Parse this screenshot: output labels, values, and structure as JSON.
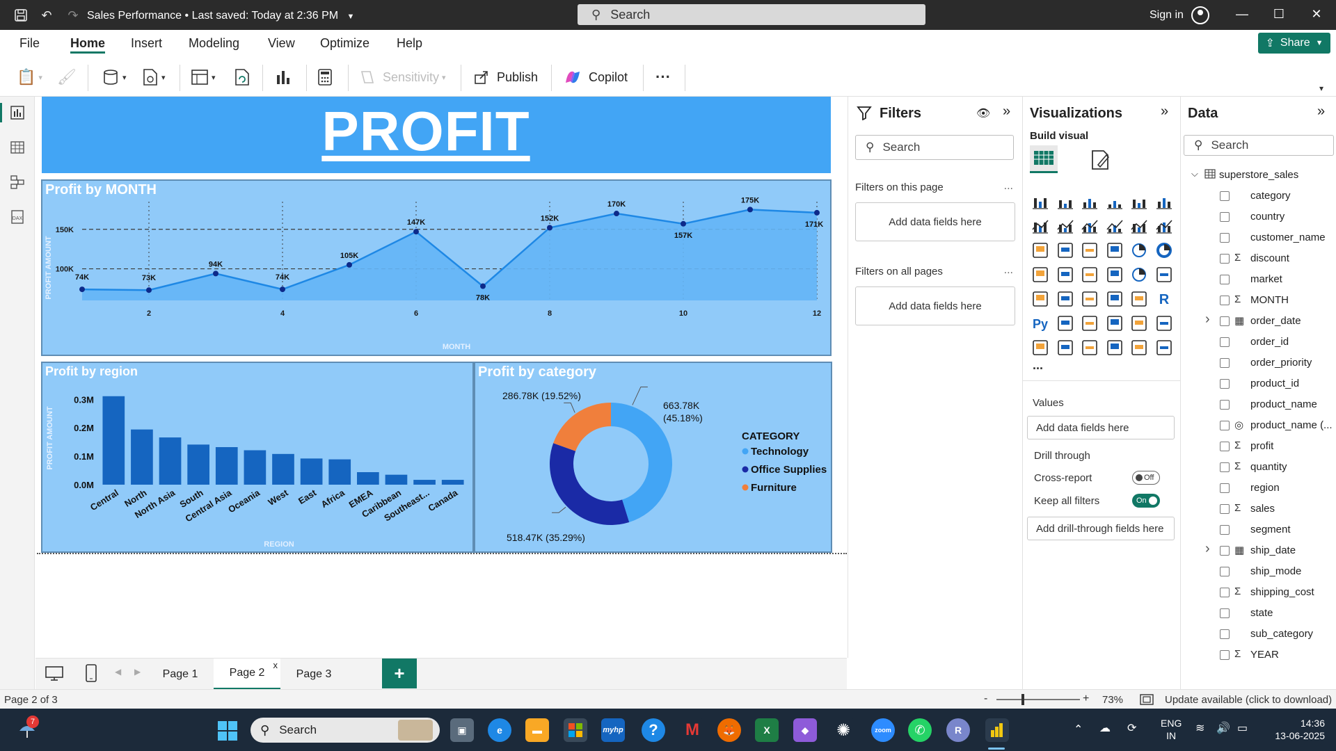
{
  "titlebar": {
    "doc_title": "Sales Performance",
    "saved_status": "Last saved: Today at 2:36 PM",
    "search_placeholder": "Search",
    "signin": "Sign in"
  },
  "menu": {
    "items": [
      "File",
      "Home",
      "Insert",
      "Modeling",
      "View",
      "Optimize",
      "Help"
    ],
    "active": "Home",
    "share": "Share"
  },
  "ribbon": {
    "sensitivity": "Sensitivity",
    "publish": "Publish",
    "copilot": "Copilot"
  },
  "report": {
    "banner_title": "PROFIT",
    "month_chart": {
      "title": "Profit by MONTH",
      "xlabel": "MONTH",
      "ylabel": "PROFIT AMOUNT"
    },
    "region_chart": {
      "title": "Profit by region",
      "xlabel": "REGION",
      "ylabel": "PROFIT AMOUNT"
    },
    "category_chart": {
      "title": "Profit by category",
      "legend_title": "CATEGORY"
    }
  },
  "chart_data": [
    {
      "type": "area",
      "title": "Profit by MONTH",
      "xlabel": "MONTH",
      "ylabel": "PROFIT AMOUNT",
      "x": [
        1,
        2,
        3,
        4,
        5,
        6,
        7,
        8,
        9,
        10,
        11,
        12
      ],
      "values": [
        74,
        73,
        94,
        74,
        105,
        147,
        78,
        152,
        170,
        157,
        175,
        171
      ],
      "data_labels": [
        "74K",
        "73K",
        "94K",
        "74K",
        "105K",
        "147K",
        "78K",
        "152K",
        "170K",
        "157K",
        "175K",
        "171K"
      ],
      "x_ticks": [
        "2",
        "4",
        "6",
        "8",
        "10",
        "12"
      ],
      "y_ticks": [
        "100K",
        "150K"
      ],
      "y_tick_values": [
        100,
        150
      ],
      "unit": "K",
      "ylim": [
        60,
        185
      ],
      "xlim": [
        1,
        12
      ],
      "grid": true,
      "colors": {
        "line": "#1e88e5",
        "fill": "#64b5f6",
        "marker": "#0d2a8a",
        "grid": "#3a3a3a"
      }
    },
    {
      "type": "bar",
      "title": "Profit by region",
      "xlabel": "REGION",
      "ylabel": "PROFIT AMOUNT",
      "categories": [
        "Central",
        "North",
        "North Asia",
        "South",
        "Central Asia",
        "Oceania",
        "West",
        "East",
        "Africa",
        "EMEA",
        "Caribbean",
        "Southeast...",
        "Canada"
      ],
      "values": [
        0.311,
        0.194,
        0.166,
        0.141,
        0.132,
        0.121,
        0.108,
        0.092,
        0.089,
        0.044,
        0.035,
        0.017,
        0.017
      ],
      "y_ticks": [
        "0.0M",
        "0.1M",
        "0.2M",
        "0.3M"
      ],
      "y_tick_values": [
        0.0,
        0.1,
        0.2,
        0.3
      ],
      "unit": "M",
      "ylim": [
        0,
        0.33
      ],
      "colors": {
        "bar": "#1565c0"
      }
    },
    {
      "type": "pie",
      "title": "Profit by category",
      "legend_title": "CATEGORY",
      "legend": "right",
      "slices": [
        {
          "name": "Technology",
          "value": 663.78,
          "percent": 45.18,
          "label_line1": "663.78K",
          "label_line2": "(45.18%)",
          "color": "#42a5f5"
        },
        {
          "name": "Office Supplies",
          "value": 518.47,
          "percent": 35.29,
          "label": "518.47K (35.29%)",
          "color": "#1a2aa6"
        },
        {
          "name": "Furniture",
          "value": 286.78,
          "percent": 19.52,
          "label": "286.78K (19.52%)",
          "color": "#f07f3c"
        }
      ]
    }
  ],
  "filters": {
    "title": "Filters",
    "search_placeholder": "Search",
    "on_this_page": "Filters on this page",
    "on_all_pages": "Filters on all pages",
    "add_fields": "Add data fields here",
    "more": "..."
  },
  "visualizations": {
    "title": "Visualizations",
    "build_visual": "Build visual",
    "more": "...",
    "values_label": "Values",
    "add_fields": "Add data fields here",
    "drill_through": "Drill through",
    "cross_report": "Cross-report",
    "cross_report_state": "Off",
    "keep_all_filters": "Keep all filters",
    "keep_all_filters_state": "On",
    "add_drill": "Add drill-through fields here"
  },
  "data_pane": {
    "title": "Data",
    "search_placeholder": "Search",
    "table_name": "superstore_sales",
    "fields": [
      {
        "name": "category",
        "sigma": false,
        "expand": false,
        "type": ""
      },
      {
        "name": "country",
        "sigma": false,
        "expand": false,
        "type": ""
      },
      {
        "name": "customer_name",
        "sigma": false,
        "expand": false,
        "type": ""
      },
      {
        "name": "discount",
        "sigma": true,
        "expand": false,
        "type": ""
      },
      {
        "name": "market",
        "sigma": false,
        "expand": false,
        "type": ""
      },
      {
        "name": "MONTH",
        "sigma": true,
        "expand": false,
        "type": ""
      },
      {
        "name": "order_date",
        "sigma": false,
        "expand": true,
        "type": "calendar"
      },
      {
        "name": "order_id",
        "sigma": false,
        "expand": false,
        "type": ""
      },
      {
        "name": "order_priority",
        "sigma": false,
        "expand": false,
        "type": ""
      },
      {
        "name": "product_id",
        "sigma": false,
        "expand": false,
        "type": ""
      },
      {
        "name": "product_name",
        "sigma": false,
        "expand": false,
        "type": ""
      },
      {
        "name": "product_name (...",
        "sigma": false,
        "expand": false,
        "type": "group"
      },
      {
        "name": "profit",
        "sigma": true,
        "expand": false,
        "type": ""
      },
      {
        "name": "quantity",
        "sigma": true,
        "expand": false,
        "type": ""
      },
      {
        "name": "region",
        "sigma": false,
        "expand": false,
        "type": ""
      },
      {
        "name": "sales",
        "sigma": true,
        "expand": false,
        "type": ""
      },
      {
        "name": "segment",
        "sigma": false,
        "expand": false,
        "type": ""
      },
      {
        "name": "ship_date",
        "sigma": false,
        "expand": true,
        "type": "calendar"
      },
      {
        "name": "ship_mode",
        "sigma": false,
        "expand": false,
        "type": ""
      },
      {
        "name": "shipping_cost",
        "sigma": true,
        "expand": false,
        "type": ""
      },
      {
        "name": "state",
        "sigma": false,
        "expand": false,
        "type": ""
      },
      {
        "name": "sub_category",
        "sigma": false,
        "expand": false,
        "type": ""
      },
      {
        "name": "YEAR",
        "sigma": true,
        "expand": false,
        "type": ""
      }
    ]
  },
  "pages": {
    "tabs": [
      "Page 1",
      "Page 2",
      "Page 3"
    ],
    "active": "Page 2",
    "add": "+"
  },
  "status": {
    "page_info": "Page 2 of 3",
    "zoom_minus": "-",
    "zoom_plus": "+",
    "zoom": "73%",
    "update": "Update available (click to download)"
  },
  "taskbar": {
    "search": "Search",
    "notification_count": "7",
    "lang_line1": "ENG",
    "lang_line2": "IN",
    "time": "14:36",
    "date": "13-06-2025",
    "mcafee_letter": "M",
    "r_letter": "R",
    "zoom_app": "zoom",
    "myhp": "myhp"
  }
}
